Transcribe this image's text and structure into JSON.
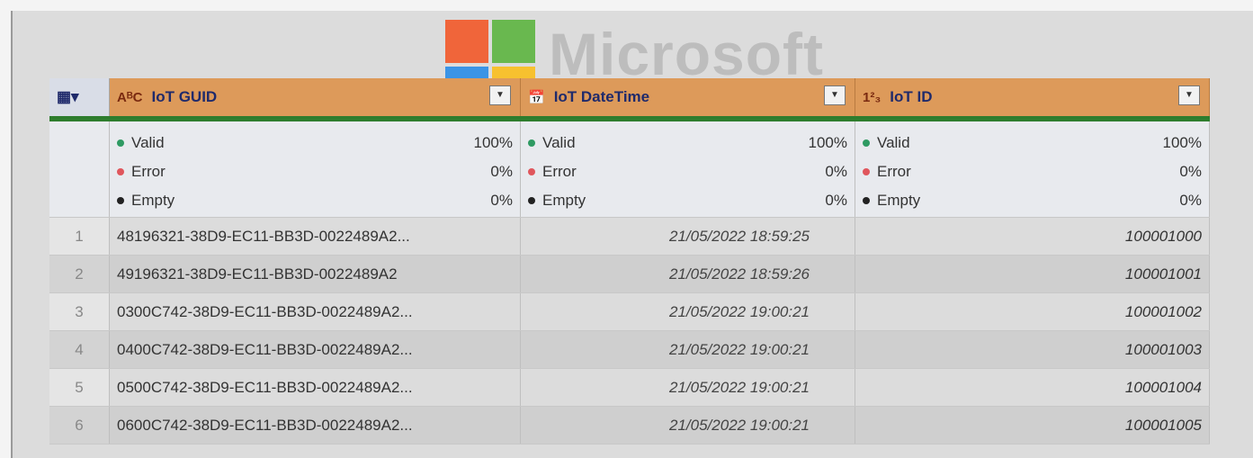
{
  "watermark": "Microsoft",
  "colors": {
    "header_bg": "#dd9a5a",
    "header_rule": "#2e7d2e",
    "valid": "#2e9a62",
    "error": "#e0565c",
    "empty": "#222222"
  },
  "icons": {
    "table": "table-icon",
    "text_type": "text-type-icon",
    "datetime_type": "datetime-type-icon",
    "number_type": "number-type-icon",
    "dropdown": "dropdown-icon"
  },
  "columns": [
    {
      "type_icon": "AᴮC",
      "name": "IoT GUID"
    },
    {
      "type_icon": "📅",
      "name": "IoT DateTime"
    },
    {
      "type_icon": "1²₃",
      "name": "IoT ID"
    }
  ],
  "quality": [
    {
      "valid_label": "Valid",
      "valid_pct": "100%",
      "error_label": "Error",
      "error_pct": "0%",
      "empty_label": "Empty",
      "empty_pct": "0%"
    },
    {
      "valid_label": "Valid",
      "valid_pct": "100%",
      "error_label": "Error",
      "error_pct": "0%",
      "empty_label": "Empty",
      "empty_pct": "0%"
    },
    {
      "valid_label": "Valid",
      "valid_pct": "100%",
      "error_label": "Error",
      "error_pct": "0%",
      "empty_label": "Empty",
      "empty_pct": "0%"
    }
  ],
  "rows": [
    {
      "n": "1",
      "guid": "48196321-38D9-EC11-BB3D-0022489A2...",
      "datetime": "21/05/2022 18:59:25",
      "id": "100001000"
    },
    {
      "n": "2",
      "guid": "49196321-38D9-EC11-BB3D-0022489A2",
      "datetime": "21/05/2022 18:59:26",
      "id": "100001001"
    },
    {
      "n": "3",
      "guid": "0300C742-38D9-EC11-BB3D-0022489A2...",
      "datetime": "21/05/2022 19:00:21",
      "id": "100001002"
    },
    {
      "n": "4",
      "guid": "0400C742-38D9-EC11-BB3D-0022489A2...",
      "datetime": "21/05/2022 19:00:21",
      "id": "100001003"
    },
    {
      "n": "5",
      "guid": "0500C742-38D9-EC11-BB3D-0022489A2...",
      "datetime": "21/05/2022 19:00:21",
      "id": "100001004"
    },
    {
      "n": "6",
      "guid": "0600C742-38D9-EC11-BB3D-0022489A2...",
      "datetime": "21/05/2022 19:00:21",
      "id": "100001005"
    }
  ]
}
